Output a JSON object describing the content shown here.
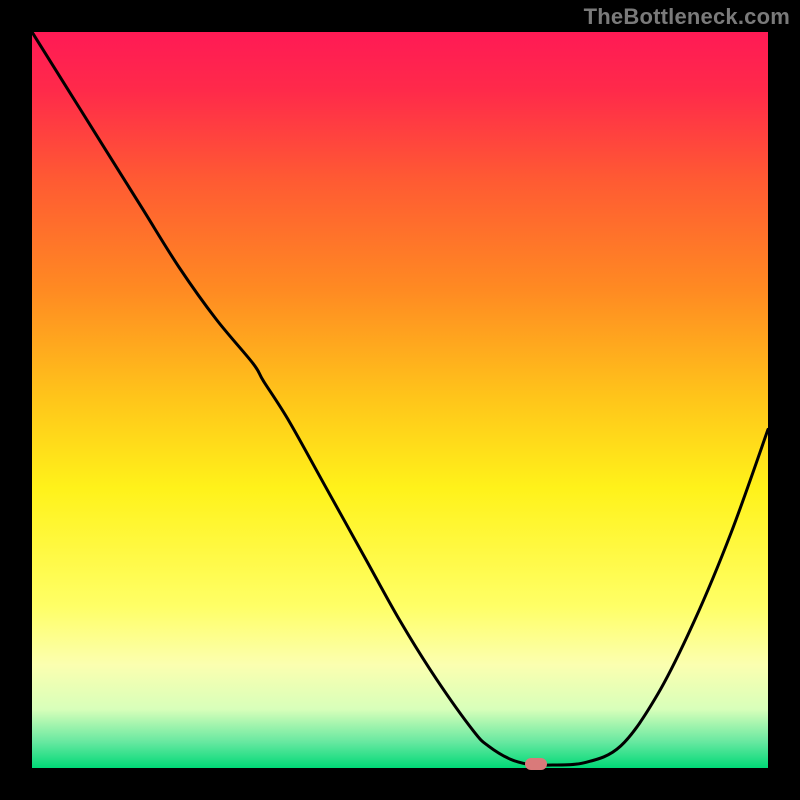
{
  "watermark": "TheBottleneck.com",
  "colors": {
    "frame_bg": "#000000",
    "curve": "#000000",
    "marker": "#d97a7a",
    "watermark": "#7a7a7a",
    "gradient_stops": [
      {
        "offset": 0.0,
        "color": "#ff1a55"
      },
      {
        "offset": 0.08,
        "color": "#ff2a4a"
      },
      {
        "offset": 0.2,
        "color": "#ff5a33"
      },
      {
        "offset": 0.35,
        "color": "#ff8a22"
      },
      {
        "offset": 0.5,
        "color": "#ffc61a"
      },
      {
        "offset": 0.62,
        "color": "#fff21a"
      },
      {
        "offset": 0.78,
        "color": "#ffff66"
      },
      {
        "offset": 0.86,
        "color": "#fbffb0"
      },
      {
        "offset": 0.92,
        "color": "#d8ffba"
      },
      {
        "offset": 0.965,
        "color": "#66e8a0"
      },
      {
        "offset": 1.0,
        "color": "#00d977"
      }
    ]
  },
  "chart_data": {
    "type": "line",
    "title": "",
    "xlabel": "",
    "ylabel": "",
    "xlim": [
      0,
      100
    ],
    "ylim": [
      0,
      100
    ],
    "grid": false,
    "legend": false,
    "series": [
      {
        "name": "curve",
        "x": [
          0,
          5,
          10,
          15,
          20,
          25,
          30,
          31.5,
          35,
          40,
          45,
          50,
          55,
          60,
          62,
          65,
          68,
          70,
          75,
          80,
          85,
          90,
          95,
          100
        ],
        "values": [
          100,
          92,
          84,
          76,
          68,
          61,
          55,
          52.5,
          47,
          38,
          29,
          20,
          12,
          5,
          3,
          1.2,
          0.4,
          0.4,
          0.7,
          3,
          10,
          20,
          32,
          46
        ]
      }
    ],
    "annotations": [
      {
        "name": "marker",
        "x": 68.5,
        "y": 0.5,
        "shape": "pill",
        "color": "#d97a7a"
      }
    ]
  }
}
